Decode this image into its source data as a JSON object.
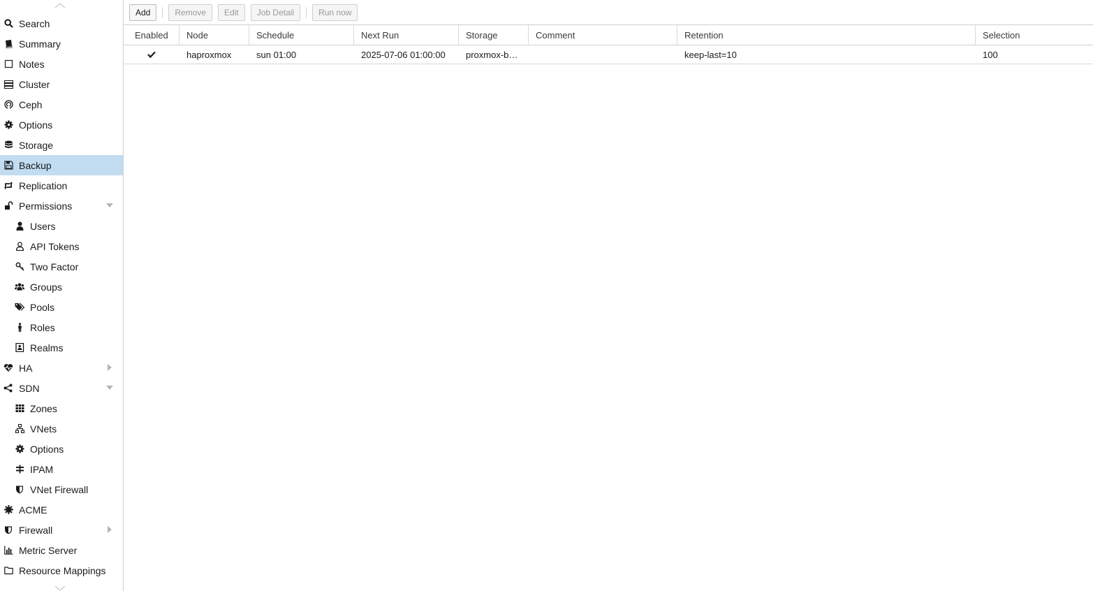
{
  "sidebar": {
    "items": [
      {
        "label": "Search",
        "icon": "search-icon"
      },
      {
        "label": "Summary",
        "icon": "book-icon"
      },
      {
        "label": "Notes",
        "icon": "note-icon"
      },
      {
        "label": "Cluster",
        "icon": "server-icon"
      },
      {
        "label": "Ceph",
        "icon": "ceph-icon"
      },
      {
        "label": "Options",
        "icon": "gear-icon"
      },
      {
        "label": "Storage",
        "icon": "database-icon"
      },
      {
        "label": "Backup",
        "icon": "floppy-icon",
        "active": true
      },
      {
        "label": "Replication",
        "icon": "retweet-icon"
      },
      {
        "label": "Permissions",
        "icon": "unlock-icon",
        "expanded": true
      },
      {
        "label": "Users",
        "icon": "user-icon"
      },
      {
        "label": "API Tokens",
        "icon": "user-outline-icon"
      },
      {
        "label": "Two Factor",
        "icon": "key-icon"
      },
      {
        "label": "Groups",
        "icon": "users-icon"
      },
      {
        "label": "Pools",
        "icon": "tags-icon"
      },
      {
        "label": "Roles",
        "icon": "male-icon"
      },
      {
        "label": "Realms",
        "icon": "address-book-icon"
      },
      {
        "label": "HA",
        "icon": "heartbeat-icon",
        "expanded": false
      },
      {
        "label": "SDN",
        "icon": "sdn-icon",
        "expanded": true
      },
      {
        "label": "Zones",
        "icon": "th-icon"
      },
      {
        "label": "VNets",
        "icon": "network-icon"
      },
      {
        "label": "Options",
        "icon": "gear-icon"
      },
      {
        "label": "IPAM",
        "icon": "ipam-icon"
      },
      {
        "label": "VNet Firewall",
        "icon": "shield-icon"
      },
      {
        "label": "ACME",
        "icon": "certificate-icon"
      },
      {
        "label": "Firewall",
        "icon": "shield-icon",
        "expanded": false
      },
      {
        "label": "Metric Server",
        "icon": "bar-chart-icon"
      },
      {
        "label": "Resource Mappings",
        "icon": "folder-icon"
      }
    ]
  },
  "toolbar": {
    "add": "Add",
    "remove": "Remove",
    "edit": "Edit",
    "job_detail": "Job Detail",
    "run_now": "Run now"
  },
  "grid": {
    "columns": [
      "Enabled",
      "Node",
      "Schedule",
      "Next Run",
      "Storage",
      "Comment",
      "Retention",
      "Selection"
    ],
    "rows": [
      {
        "enabled": true,
        "node": "haproxmox",
        "schedule": "sun 01:00",
        "next_run": "2025-07-06 01:00:00",
        "storage": "proxmox-b…",
        "comment": "",
        "retention": "keep-last=10",
        "selection": "100"
      }
    ]
  },
  "colors": {
    "active_bg": "#c2ddf2",
    "border": "#cfcfcf"
  }
}
